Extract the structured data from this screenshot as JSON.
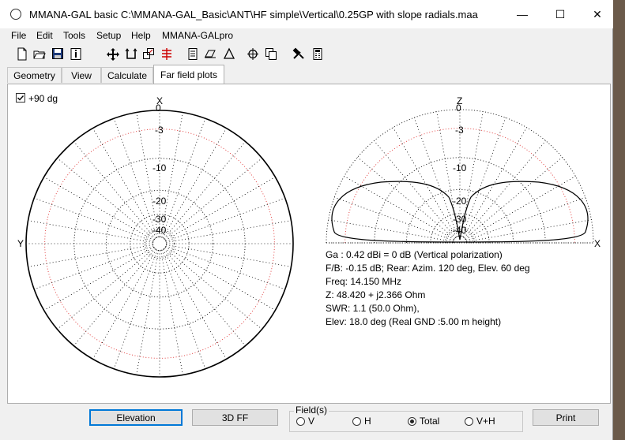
{
  "window": {
    "title": "MMANA-GAL basic C:\\MMANA-GAL_Basic\\ANT\\HF simple\\Vertical\\0.25GP with slope radials.maa",
    "minimize": "—",
    "maximize": "☐",
    "close": "✕"
  },
  "menu": [
    "File",
    "Edit",
    "Tools",
    "Setup",
    "Help",
    "MMANA-GALpro"
  ],
  "toolbar_icons": [
    "new-icon",
    "open-icon",
    "save-icon",
    "info-icon",
    "move-icon",
    "rotate-icon",
    "scale-icon",
    "wires-icon",
    "doc-icon",
    "print-icon",
    "triangle-icon",
    "target-icon",
    "copy-icon",
    "tools-icon",
    "calculator-icon"
  ],
  "tabs": [
    {
      "label": "Geometry",
      "active": false
    },
    {
      "label": "View",
      "active": false
    },
    {
      "label": "Calculate",
      "active": false
    },
    {
      "label": "Far field plots",
      "active": true
    }
  ],
  "horizontal_plot": {
    "checkbox_label": "+90 dg",
    "checked": true,
    "axis_top": "X",
    "axis_left": "Y",
    "rings": [
      "0",
      "-3",
      "-10",
      "-20",
      "-30",
      "-40"
    ]
  },
  "vertical_plot": {
    "axis_top": "Z",
    "axis_right": "X",
    "rings": [
      "0",
      "-3",
      "-10",
      "-20",
      "-30",
      "-40"
    ]
  },
  "results": {
    "ga": "Ga : 0.42 dBi = 0 dB  (Vertical polarization)",
    "fb": "F/B: -0.15 dB; Rear: Azim. 120 deg,  Elev. 60 deg",
    "freq": "Freq: 14.150 MHz",
    "z": "Z: 48.420 + j2.366 Ohm",
    "swr": "SWR: 1.1 (50.0 Ohm),",
    "elev": "Elev: 18.0 deg (Real GND  :5.00 m height)"
  },
  "buttons": {
    "elevation": "Elevation",
    "ff3d": "3D FF",
    "print": "Print"
  },
  "field_group": {
    "label": "Field(s)",
    "options": [
      {
        "label": "V",
        "selected": false
      },
      {
        "label": "H",
        "selected": false
      },
      {
        "label": "Total",
        "selected": true
      },
      {
        "label": "V+H",
        "selected": false
      }
    ]
  },
  "colors": {
    "plot_grid": "#000000",
    "minus3_ring": "#e03030",
    "active_button_border": "#0078d7"
  }
}
